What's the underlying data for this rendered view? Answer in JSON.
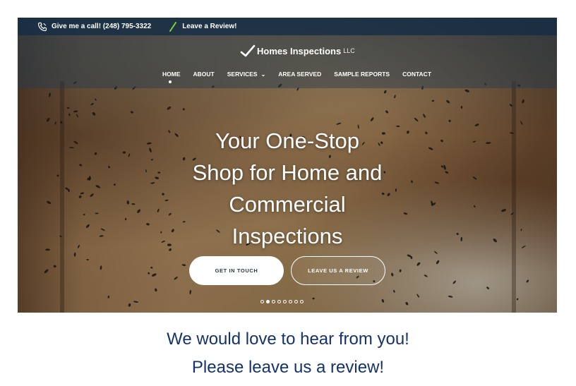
{
  "topbar": {
    "phone_text": "Give me a call! (248) 795-3322",
    "review_text": "Leave a Review!"
  },
  "logo": {
    "name": "Homes Inspections",
    "suffix": "LLC"
  },
  "nav": {
    "items": [
      {
        "label": "HOME",
        "active": true
      },
      {
        "label": "ABOUT"
      },
      {
        "label": "SERVICES"
      },
      {
        "label": "AREA SERVED"
      },
      {
        "label": "SAMPLE REPORTS"
      },
      {
        "label": "CONTACT"
      }
    ]
  },
  "hero": {
    "headline_lines": [
      "Your One-Stop",
      "Shop for Home and",
      "Commercial",
      "Inspections"
    ],
    "primary_button": "GET IN TOUCH",
    "secondary_button": "LEAVE US A REVIEW",
    "slides_total": 8,
    "slide_active": 2
  },
  "tagline": {
    "line1": "We would love to hear from you!",
    "line2": "Please leave us a review!"
  },
  "colors": {
    "topbar_bg": "#162d46",
    "tagline": "#15336b",
    "accent_green": "#7fcf3a"
  }
}
